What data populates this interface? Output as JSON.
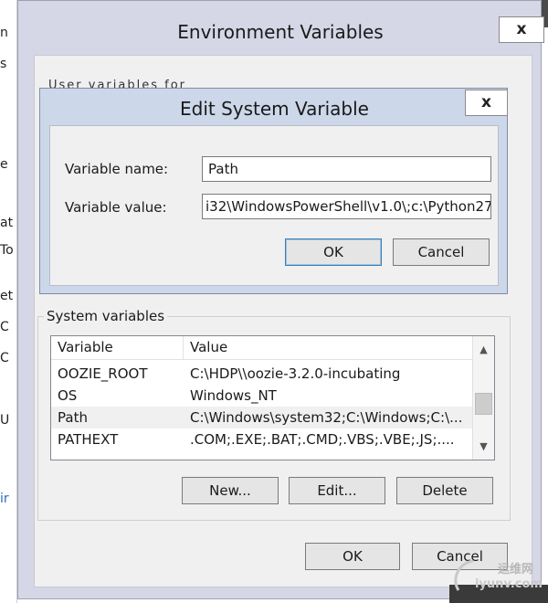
{
  "background": {
    "left_letters": [
      "n",
      "s",
      "e",
      "at",
      "To",
      "et",
      "C",
      "C",
      "U",
      "ir"
    ]
  },
  "env_dialog": {
    "title": "Environment Variables",
    "close_glyph": "x",
    "hidden_user_label": "User variables for Administrator",
    "system_group_label": "System variables",
    "columns": [
      "Variable",
      "Value"
    ],
    "rows": [
      {
        "variable": "OOZIE_ROOT",
        "value": "C:\\HDP\\\\oozie-3.2.0-incubating"
      },
      {
        "variable": "OS",
        "value": "Windows_NT"
      },
      {
        "variable": "Path",
        "value": "C:\\Windows\\system32;C:\\Windows;C:\\..."
      },
      {
        "variable": "PATHEXT",
        "value": ".COM;.EXE;.BAT;.CMD;.VBS;.VBE;.JS;...."
      }
    ],
    "buttons": {
      "new": "New...",
      "edit": "Edit...",
      "delete": "Delete",
      "ok": "OK",
      "cancel": "Cancel"
    }
  },
  "edit_dialog": {
    "title": "Edit System Variable",
    "close_glyph": "x",
    "name_label": "Variable name:",
    "name_value": "Path",
    "value_label": "Variable value:",
    "value_value": "i32\\WindowsPowerShell\\v1.0\\;c:\\Python27",
    "ok": "OK",
    "cancel": "Cancel"
  },
  "watermark": {
    "line1": "运维网",
    "line2": "iyunv.com"
  }
}
